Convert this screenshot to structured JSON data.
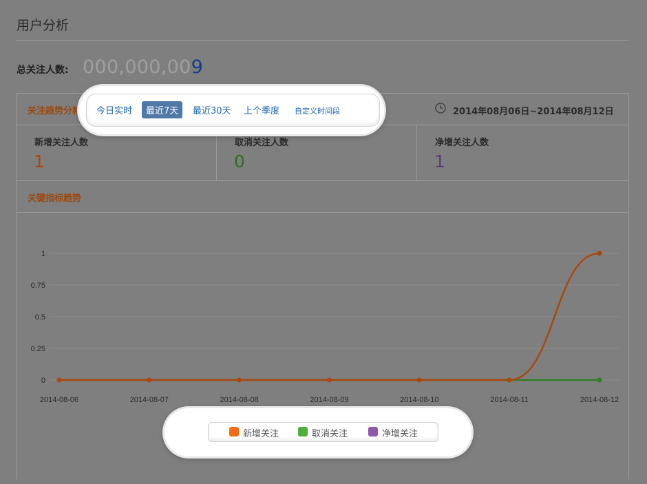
{
  "page": {
    "title": "用户分析",
    "total_label": "总关注人数:",
    "total_value_prefix": "000,000,00",
    "total_value_last": "9"
  },
  "trend": {
    "title": "关注趋势分析",
    "date_range": "2014年08月06日~2014年08月12日",
    "range_tabs": [
      "今日实时",
      "最近7天",
      "最近30天",
      "上个季度",
      "自定义时间段"
    ],
    "active_tab": "最近7天"
  },
  "stats": [
    {
      "label": "新增关注人数",
      "value": "1",
      "color": "#a8480f"
    },
    {
      "label": "取消关注人数",
      "value": "0",
      "color": "#2f6e1f"
    },
    {
      "label": "净增关注人数",
      "value": "1",
      "color": "#5a3a78"
    }
  ],
  "kpi": {
    "title": "关键指标趋势"
  },
  "chart_data": {
    "type": "line",
    "x": [
      "2014-08-06",
      "2014-08-07",
      "2014-08-08",
      "2014-08-09",
      "2014-08-10",
      "2014-08-11",
      "2014-08-12"
    ],
    "y_ticks": [
      "0",
      "0.25",
      "0.5",
      "0.75",
      "1"
    ],
    "ylim": [
      0,
      1
    ],
    "series": [
      {
        "name": "新增关注",
        "color": "#a8480f",
        "values": [
          0,
          0,
          0,
          0,
          0,
          0,
          1
        ]
      },
      {
        "name": "取消关注",
        "color": "#2f7d25",
        "values": [
          0,
          0,
          0,
          0,
          0,
          0,
          0
        ]
      },
      {
        "name": "净增关注",
        "color": "#6a4a8a",
        "values": [
          0,
          0,
          0,
          0,
          0,
          0,
          1
        ]
      }
    ],
    "legend": [
      {
        "label": "新增关注",
        "color": "#f36b13"
      },
      {
        "label": "取消关注",
        "color": "#4caf3a"
      },
      {
        "label": "净增关注",
        "color": "#8e5aa8"
      }
    ],
    "grid": true
  }
}
